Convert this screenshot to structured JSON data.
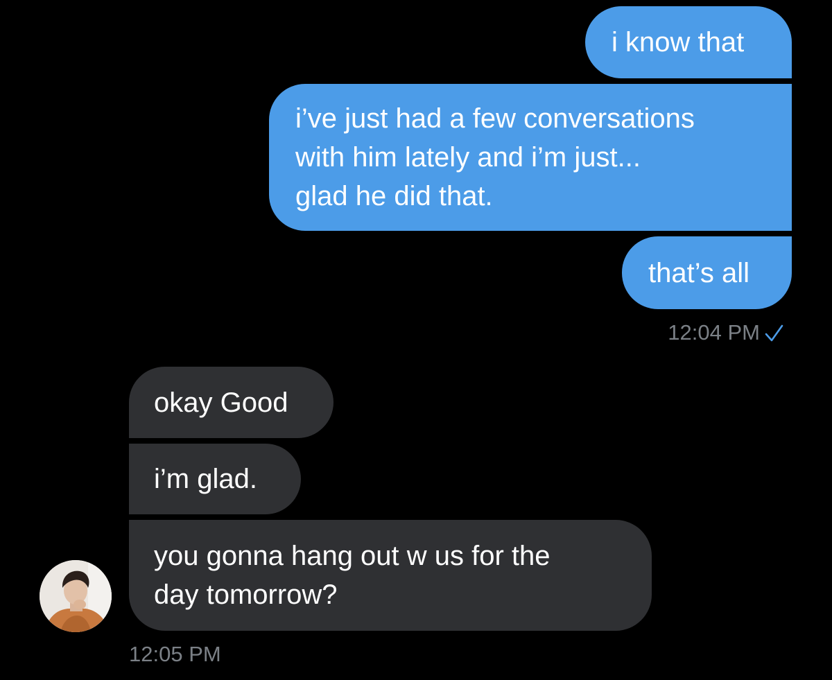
{
  "colors": {
    "background": "#000000",
    "sent_bubble": "#4c9ce8",
    "received_bubble": "#2f3033",
    "timestamp": "#7b8086",
    "read_check": "#4c9ce8"
  },
  "conversation": {
    "sent_group": {
      "messages": [
        {
          "text": "i know that"
        },
        {
          "text": "i’ve just had a few conversations\nwith him lately and i’m just...\nglad he did that."
        },
        {
          "text": "that’s all"
        }
      ],
      "timestamp": "12:04 PM",
      "status_icon": "read-checkmark-icon"
    },
    "received_group": {
      "messages": [
        {
          "text": "okay Good"
        },
        {
          "text": "i’m glad."
        },
        {
          "text": "you gonna hang out w us for the\nday tomorrow?"
        }
      ],
      "timestamp": "12:05 PM",
      "avatar_icon": "user-avatar-photo"
    }
  }
}
